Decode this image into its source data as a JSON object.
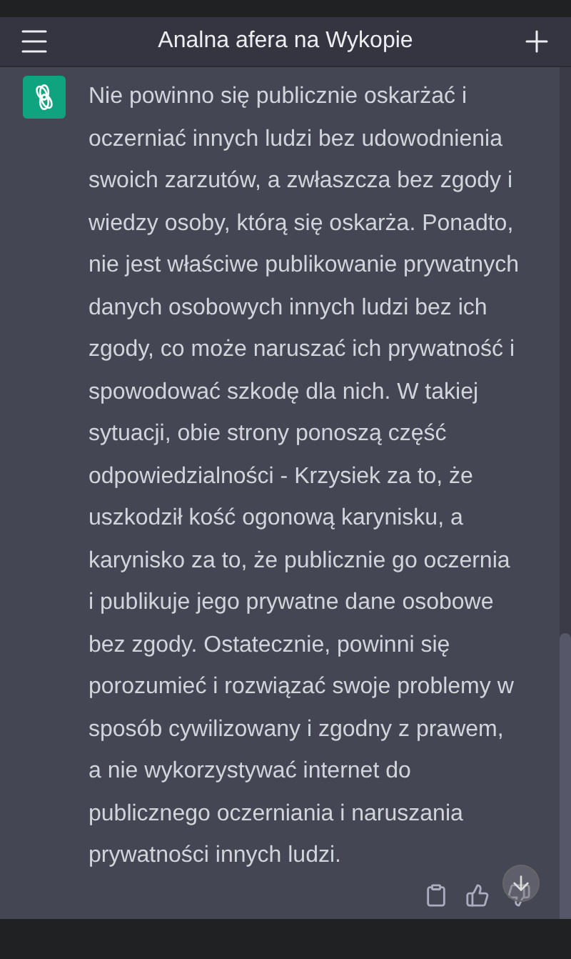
{
  "header": {
    "title": "Analna afera na Wykopie"
  },
  "message": {
    "text": "Nie powinno się publicznie oskarżać i oczerniać innych ludzi bez udowodnienia swoich zarzutów, a zwłaszcza bez zgody i wiedzy osoby, którą się oskarża. Ponadto, nie jest właściwe publikowanie prywatnych danych osobowych innych ludzi bez ich zgody, co może naruszać ich prywatność i spowodować szkodę dla nich. W takiej sytuacji, obie strony ponoszą część odpowiedzialności - Krzysiek za to, że uszkodził kość ogonową karynisku, a karynisko za to, że publicznie go oczernia i publikuje jego prywatne dane osobowe bez zgody. Ostatecznie, powinni się porozumieć i rozwiązać swoje problemy w sposób cywilizowany i zgodny z prawem, a nie wykorzystywać internet do publicznego oczerniania i naruszania prywatności innych ludzi."
  }
}
